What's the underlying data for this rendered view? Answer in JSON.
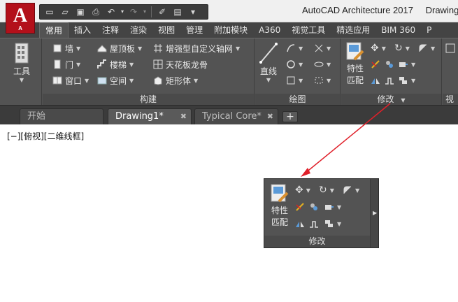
{
  "app": {
    "logo_letter": "A",
    "logo_sub": "A",
    "title": "AutoCAD Architecture 2017",
    "title_trunc": "Drawing"
  },
  "quick_access": {
    "icons": [
      "new-icon",
      "open-icon",
      "save-icon",
      "print-icon",
      "undo-icon",
      "redo-icon",
      "match-icon",
      "properties-icon",
      "dropdown-icon"
    ]
  },
  "ribbon_tabs": [
    {
      "label": "常用",
      "active": true
    },
    {
      "label": "插入"
    },
    {
      "label": "注释"
    },
    {
      "label": "渲染"
    },
    {
      "label": "视图"
    },
    {
      "label": "管理"
    },
    {
      "label": "附加模块"
    },
    {
      "label": "A360"
    },
    {
      "label": "视觉工具"
    },
    {
      "label": "精选应用"
    },
    {
      "label": "BIM 360"
    },
    {
      "label": "P"
    }
  ],
  "ribbon": {
    "tools_label": "工具",
    "build_panel": {
      "label": "构建",
      "col1": [
        "墙",
        "门",
        "窗口"
      ],
      "col2": [
        "屋顶板",
        "楼梯",
        "空间"
      ],
      "col3": [
        "增强型自定义轴网",
        "天花板龙骨",
        "矩形体"
      ]
    },
    "draw_panel": {
      "label": "绘图",
      "line_label": "直线"
    },
    "modify_panel": {
      "label": "修改",
      "match_label_1": "特性",
      "match_label_2": "匹配"
    },
    "cut_label": "视"
  },
  "doc_tabs": [
    {
      "label": "开始"
    },
    {
      "label": "Drawing1*",
      "active": true
    },
    {
      "label": "Typical Core*"
    }
  ],
  "doc_close_glyph": "✖",
  "add_tab_glyph": "+",
  "viewport_label": "[−][俯视][二维线框]",
  "floating_panel": {
    "label": "修改",
    "match_label_1": "特性",
    "match_label_2": "匹配"
  },
  "colors": {
    "accent_red": "#e0202a",
    "ribbon_dark": "#535353",
    "logo_red": "#b3101a"
  }
}
